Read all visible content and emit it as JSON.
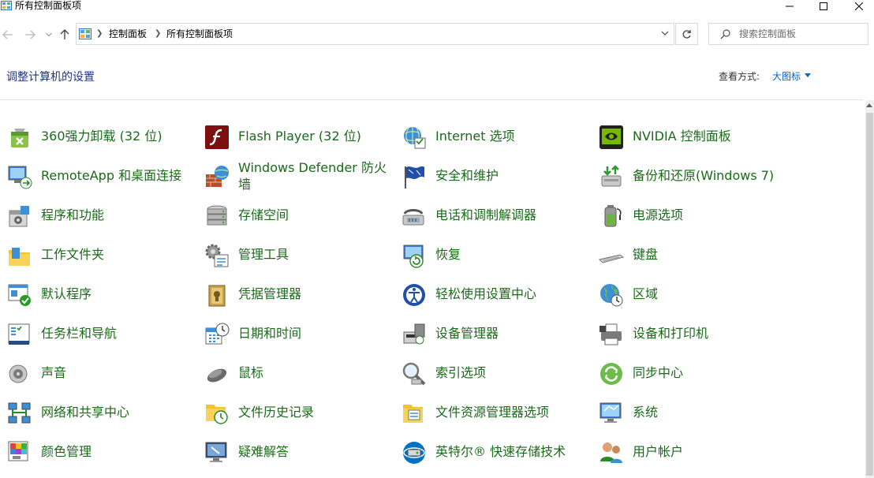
{
  "window": {
    "title": "所有控制面板项"
  },
  "address": {
    "crumbs": [
      "控制面板",
      "所有控制面板项"
    ]
  },
  "search": {
    "placeholder": "搜索控制面板"
  },
  "header": {
    "title": "调整计算机的设置",
    "view_by_label": "查看方式:",
    "view_by_value": "大图标"
  },
  "items": [
    {
      "label": "360强力卸载 (32 位)",
      "icon": "uninstall-icon"
    },
    {
      "label": "Flash Player (32 位)",
      "icon": "flash-icon"
    },
    {
      "label": "Internet 选项",
      "icon": "internet-options-icon"
    },
    {
      "label": "NVIDIA 控制面板",
      "icon": "nvidia-icon"
    },
    {
      "label": "RemoteApp 和桌面连接",
      "icon": "remoteapp-icon"
    },
    {
      "label": "Windows Defender 防火墙",
      "icon": "firewall-icon"
    },
    {
      "label": "安全和维护",
      "icon": "security-flag-icon"
    },
    {
      "label": "备份和还原(Windows 7)",
      "icon": "backup-icon"
    },
    {
      "label": "程序和功能",
      "icon": "programs-icon"
    },
    {
      "label": "存储空间",
      "icon": "storage-icon"
    },
    {
      "label": "电话和调制解调器",
      "icon": "phone-modem-icon"
    },
    {
      "label": "电源选项",
      "icon": "power-icon"
    },
    {
      "label": "工作文件夹",
      "icon": "work-folders-icon"
    },
    {
      "label": "管理工具",
      "icon": "admin-tools-icon"
    },
    {
      "label": "恢复",
      "icon": "recovery-icon"
    },
    {
      "label": "键盘",
      "icon": "keyboard-icon"
    },
    {
      "label": "默认程序",
      "icon": "default-programs-icon"
    },
    {
      "label": "凭据管理器",
      "icon": "credential-icon"
    },
    {
      "label": "轻松使用设置中心",
      "icon": "ease-of-access-icon"
    },
    {
      "label": "区域",
      "icon": "region-icon"
    },
    {
      "label": "任务栏和导航",
      "icon": "taskbar-icon"
    },
    {
      "label": "日期和时间",
      "icon": "date-time-icon"
    },
    {
      "label": "设备管理器",
      "icon": "device-manager-icon"
    },
    {
      "label": "设备和打印机",
      "icon": "printer-icon"
    },
    {
      "label": "声音",
      "icon": "sound-icon"
    },
    {
      "label": "鼠标",
      "icon": "mouse-icon"
    },
    {
      "label": "索引选项",
      "icon": "indexing-icon"
    },
    {
      "label": "同步中心",
      "icon": "sync-icon"
    },
    {
      "label": "网络和共享中心",
      "icon": "network-icon"
    },
    {
      "label": "文件历史记录",
      "icon": "file-history-icon"
    },
    {
      "label": "文件资源管理器选项",
      "icon": "explorer-options-icon"
    },
    {
      "label": "系统",
      "icon": "system-icon"
    },
    {
      "label": "颜色管理",
      "icon": "color-management-icon"
    },
    {
      "label": "疑难解答",
      "icon": "troubleshooting-icon"
    },
    {
      "label": "英特尔® 快速存储技术",
      "icon": "intel-rst-icon"
    },
    {
      "label": "用户帐户",
      "icon": "user-accounts-icon"
    }
  ],
  "colors": {
    "heading": "#1e3287",
    "link": "#0066cc",
    "item_label": "#1a6a1a"
  }
}
